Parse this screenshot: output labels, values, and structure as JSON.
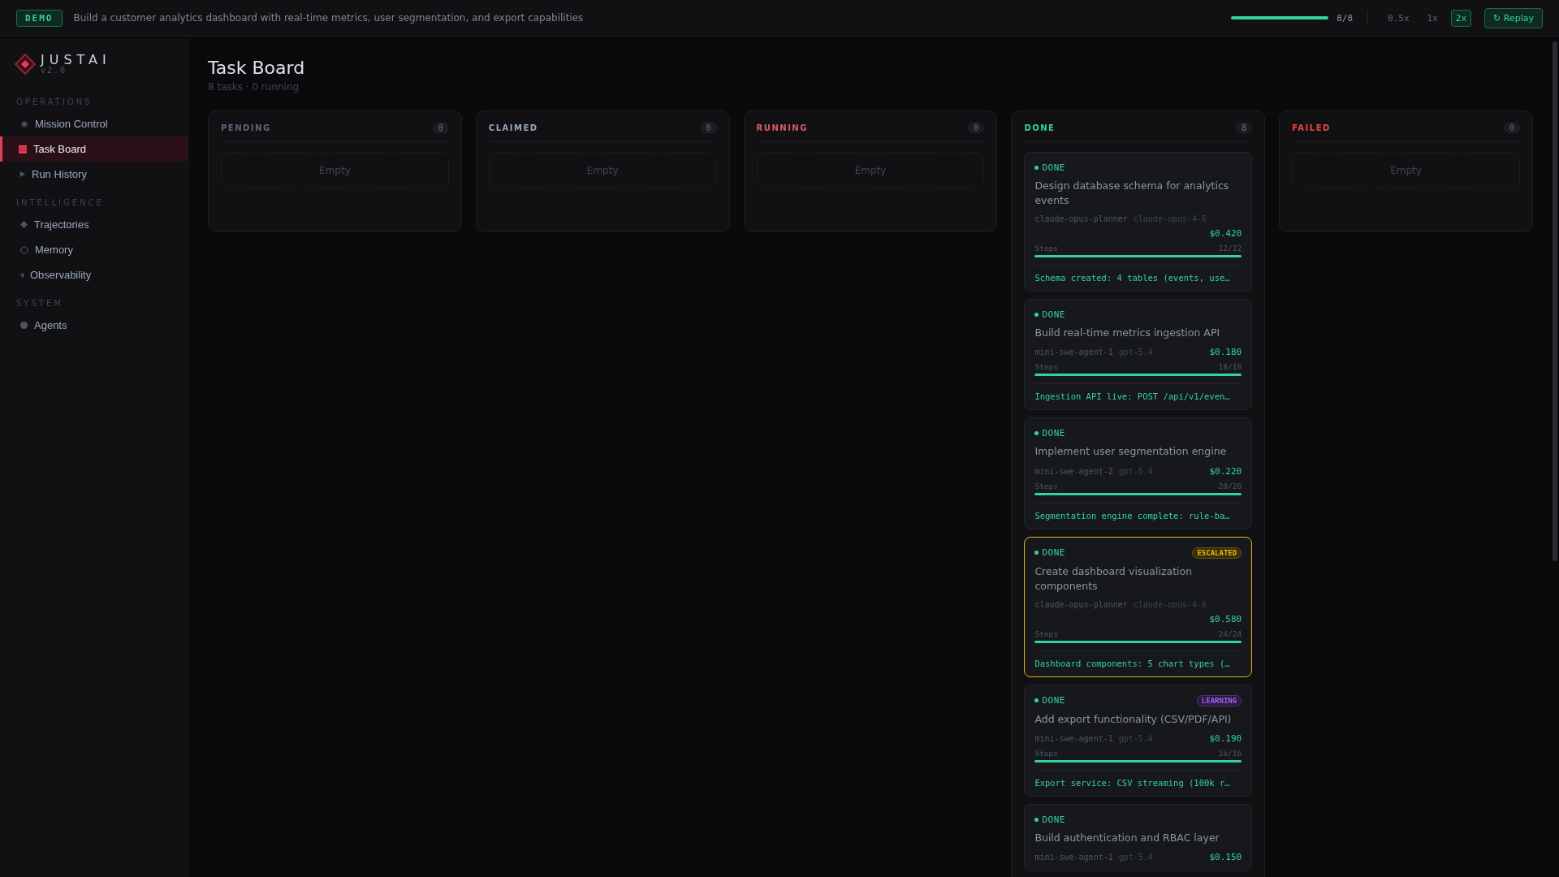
{
  "top_bar": {
    "badge": "DEMO",
    "description": "Build a customer analytics dashboard with real-time metrics, user segmentation, and export capabilities",
    "progress": {
      "level": 1,
      "reading": "8/8"
    },
    "speeds": [
      {
        "label": "0.5x",
        "selected": false
      },
      {
        "label": "1x",
        "selected": false
      },
      {
        "label": "2x",
        "selected": true
      }
    ],
    "replay": {
      "icon": "↻",
      "label": "Replay"
    }
  },
  "sidebar": {
    "logo": "JUSTAI",
    "version": "v2.0",
    "sections": [
      {
        "title": "OPERATIONS",
        "items": [
          {
            "label": "Mission Control",
            "kind": "target",
            "selected": false
          },
          {
            "label": "Task Board",
            "kind": "grid",
            "selected": true
          },
          {
            "label": "Run History",
            "kind": "play",
            "selected": false
          }
        ]
      },
      {
        "title": "INTELLIGENCE",
        "items": [
          {
            "label": "Trajectories",
            "kind": "diamond",
            "selected": false
          },
          {
            "label": "Memory",
            "kind": "hexagon",
            "selected": false
          },
          {
            "label": "Observability",
            "kind": "chevron",
            "selected": false
          }
        ]
      },
      {
        "title": "SYSTEM",
        "items": [
          {
            "label": "Agents",
            "kind": "dot",
            "selected": false
          }
        ]
      }
    ]
  },
  "page": {
    "title": "Task Board",
    "subtitle": "8 tasks · 0 running"
  },
  "columns": [
    {
      "title": "PENDING",
      "color": "#5d6678",
      "count": "0",
      "empty": "Empty"
    },
    {
      "title": "CLAIMED",
      "color": "#9aa8bd",
      "count": "0",
      "empty": "Empty"
    },
    {
      "title": "RUNNING",
      "color": "#e05a6a",
      "count": "0",
      "empty": "Empty"
    },
    {
      "title": "DONE",
      "color": "#34d399",
      "count": "8",
      "cards": [
        {
          "status": "DONE",
          "title": "Design database schema for analytics events",
          "agent": "claude-opus-planner",
          "model": "claude-opus-4-6",
          "cost": "$0.420",
          "steps_label": "Steps",
          "steps": "12/12",
          "level": 1,
          "result": "Schema created: 4 tables (events, use…"
        },
        {
          "status": "DONE",
          "title": "Build real-time metrics ingestion API",
          "agent": "mini-swe-agent-1",
          "model": "gpt-5.4",
          "cost": "$0.180",
          "steps_label": "Steps",
          "steps": "18/18",
          "level": 1,
          "result": "Ingestion API live: POST /api/v1/even…"
        },
        {
          "status": "DONE",
          "title": "Implement user segmentation engine",
          "agent": "mini-swe-agent-2",
          "model": "gpt-5.4",
          "cost": "$0.220",
          "steps_label": "Steps",
          "steps": "20/20",
          "level": 1,
          "result": "Segmentation engine complete: rule-ba…"
        },
        {
          "status": "DONE",
          "badge": {
            "label": "ESCALATED",
            "kind": "escalated"
          },
          "title": "Create dashboard visualization components",
          "agent": "claude-opus-planner",
          "model": "claude-opus-4-6",
          "cost": "$0.580",
          "steps_label": "Steps",
          "steps": "24/24",
          "level": 1,
          "result": "Dashboard components: 5 chart types (…"
        },
        {
          "status": "DONE",
          "badge": {
            "label": "LEARNING",
            "kind": "learning"
          },
          "title": "Add export functionality (CSV/PDF/API)",
          "agent": "mini-swe-agent-1",
          "model": "gpt-5.4",
          "cost": "$0.190",
          "steps_label": "Steps",
          "steps": "16/16",
          "level": 1,
          "result": "Export service: CSV streaming (100k r…"
        },
        {
          "status": "DONE",
          "title": "Build authentication and RBAC layer",
          "agent": "mini-swe-agent-1",
          "model": "gpt-5.4",
          "cost": "$0.150"
        }
      ]
    },
    {
      "title": "FAILED",
      "color": "#ef4444",
      "count": "0",
      "empty": "Empty"
    }
  ]
}
